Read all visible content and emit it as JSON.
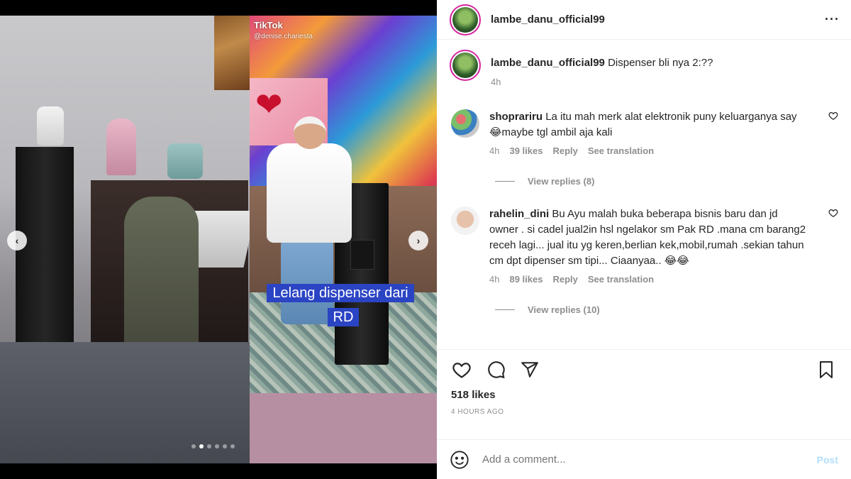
{
  "media": {
    "tiktok_brand": "TikTok",
    "tiktok_handle": "@denise.chariesta",
    "caption": "Lelang dispenser dari RD",
    "carousel": {
      "total": 6,
      "active": 1
    }
  },
  "post": {
    "username": "lambe_danu_official99",
    "caption_user": "lambe_danu_official99",
    "caption_text": "Dispenser bli nya 2:??",
    "caption_time": "4h",
    "comments": [
      {
        "user": "shoprariru",
        "text": "La itu mah merk alat elektronik puny keluarganya say😂maybe tgl ambil aja kali",
        "time": "4h",
        "likes": "39 likes",
        "reply": "Reply",
        "translation": "See translation",
        "view_replies": "View replies (8)"
      },
      {
        "user": "rahelin_dini",
        "text": "Bu Ayu malah buka beberapa bisnis baru dan jd owner . si cadel jual2in hsl ngelakor sm Pak RD .mana cm barang2 receh lagi... jual itu yg keren,berlian kek,mobil,rumah .sekian tahun cm dpt dipenser sm tipi... Ciaanyaa.. 😂😂",
        "time": "4h",
        "likes": "89 likes",
        "reply": "Reply",
        "translation": "See translation",
        "view_replies": "View replies (10)"
      }
    ],
    "likes": "518 likes",
    "posted": "4 HOURS AGO",
    "add_comment_placeholder": "Add a comment...",
    "post_button": "Post"
  },
  "icons": {
    "more": "more-options-icon",
    "heart": "heart-icon",
    "comment": "comment-icon",
    "share": "share-icon",
    "bookmark": "bookmark-icon",
    "emoji": "emoji-icon",
    "prev": "chevron-left-icon",
    "next": "chevron-right-icon"
  },
  "colors": {
    "caption_bg": "#2b44c4",
    "post_link": "#b2dffc",
    "muted": "#8e8e8e",
    "text": "#262626"
  }
}
